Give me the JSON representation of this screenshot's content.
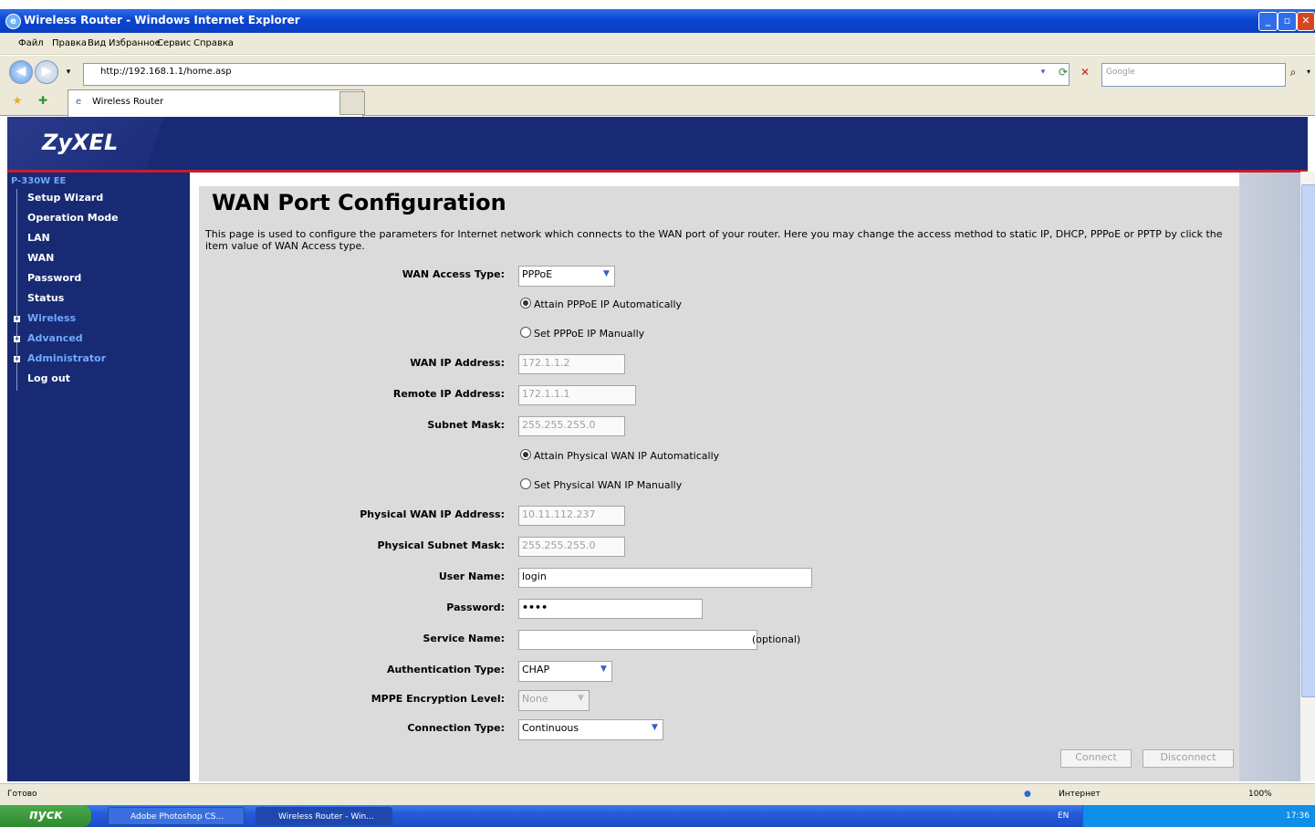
{
  "window": {
    "title": "Wireless Router - Windows Internet Explorer"
  },
  "menu": {
    "items": [
      "Файл",
      "Правка",
      "Вид",
      "Избранное",
      "Сервис",
      "Справка"
    ]
  },
  "address": {
    "url": "http://192.168.1.1/home.asp",
    "search_placeholder": "Google"
  },
  "tab": {
    "title": "Wireless Router"
  },
  "router": {
    "logo": "ZyXEL",
    "model": "P-330W EE",
    "nav": [
      {
        "label": "Setup Wizard"
      },
      {
        "label": "Operation Mode"
      },
      {
        "label": "LAN"
      },
      {
        "label": "WAN"
      },
      {
        "label": "Password"
      },
      {
        "label": "Status"
      },
      {
        "label": "Wireless"
      },
      {
        "label": "Advanced"
      },
      {
        "label": "Administrator"
      },
      {
        "label": "Log out"
      }
    ]
  },
  "content": {
    "title": "WAN Port Configuration",
    "description": "This page is used to configure the parameters for Internet network which connects to the WAN port of your router. Here you may change the access method to static IP, DHCP, PPPoE or PPTP by click the item value of WAN Access type.",
    "wan_access_type_label": "WAN Access Type:",
    "wan_access_type_value": "PPPoE",
    "radio_pppoe_auto": "Attain PPPoE IP Automatically",
    "radio_pppoe_manual": "Set PPPoE IP Manually",
    "wan_ip_label": "WAN IP Address:",
    "wan_ip_value": "172.1.1.2",
    "remote_ip_label": "Remote IP Address:",
    "remote_ip_value": "172.1.1.1",
    "subnet_label": "Subnet Mask:",
    "subnet_value": "255.255.255.0",
    "radio_phys_auto": "Attain Physical WAN IP Automatically",
    "radio_phys_manual": "Set Physical WAN IP Manually",
    "phys_ip_label": "Physical WAN IP Address:",
    "phys_ip_value": "10.11.112.237",
    "phys_subnet_label": "Physical Subnet Mask:",
    "phys_subnet_value": "255.255.255.0",
    "username_label": "User Name:",
    "username_value": "login",
    "password_label": "Password:",
    "password_value": "••••",
    "service_label": "Service Name:",
    "service_value": "",
    "service_note": "(optional)",
    "auth_label": "Authentication Type:",
    "auth_value": "CHAP",
    "mppe_label": "MPPE Encryption Level:",
    "mppe_value": "None",
    "conn_label": "Connection Type:",
    "conn_value": "Continuous",
    "connect_button": "Connect",
    "disconnect_button": "Disconnect"
  },
  "status": {
    "text": "Готово",
    "zone": "Интернет",
    "zoom": "100%"
  },
  "taskbar": {
    "start": "пуск",
    "tasks": [
      "Adobe Photoshop CS...",
      "Wireless Router - Win..."
    ],
    "lang": "EN",
    "clock": "17:36"
  }
}
